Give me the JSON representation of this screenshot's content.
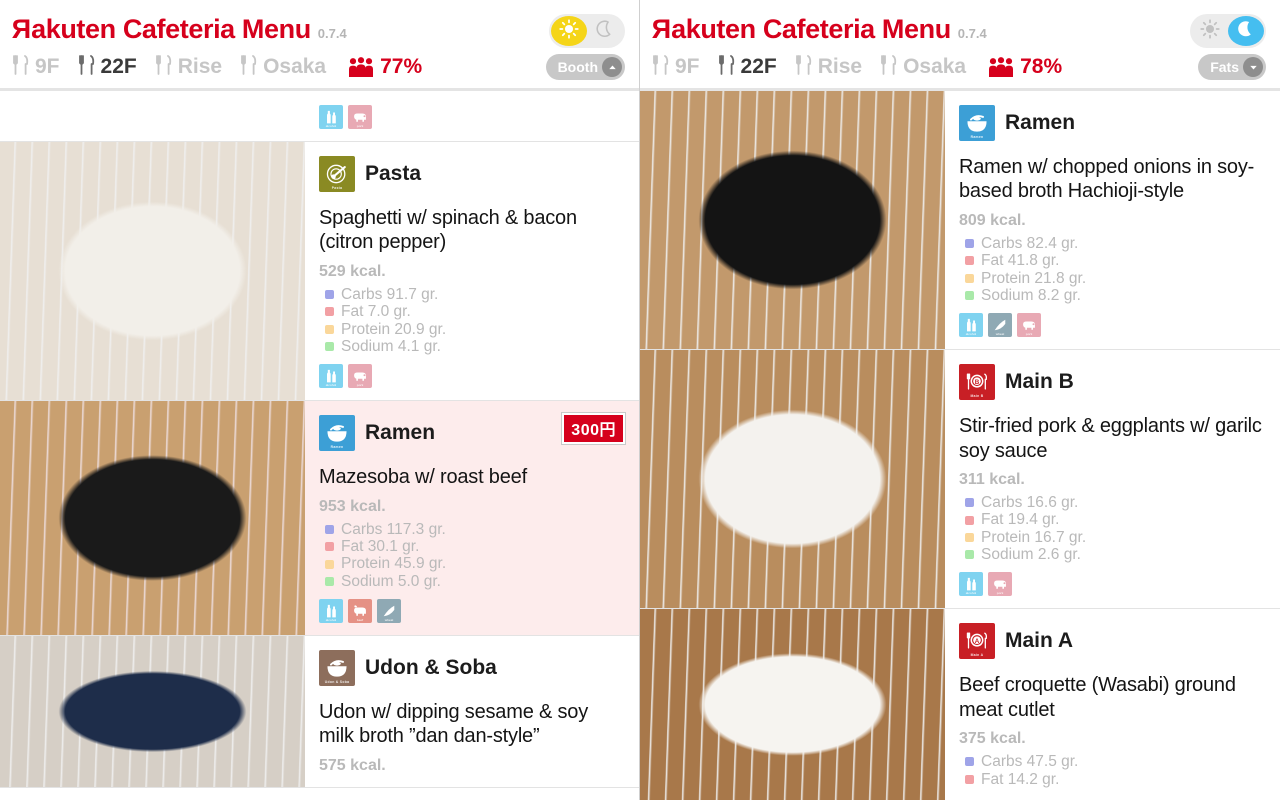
{
  "app": {
    "brand_prefix": "R",
    "brand_rest": "akuten Cafeteria Menu",
    "version": "0.7.4"
  },
  "panels": [
    {
      "id": "left",
      "theme": "day",
      "header": {
        "nav": [
          {
            "label": "9F",
            "active": false
          },
          {
            "label": "22F",
            "active": true
          },
          {
            "label": "Rise",
            "active": false
          },
          {
            "label": "Osaka",
            "active": false
          }
        ],
        "occupancy": "77%",
        "occupancy_icon": "crowd-icon",
        "daynight": {
          "sun_active": true,
          "moon_active": false
        },
        "mode_pill": {
          "label": "Booth",
          "chevron": "chevron-up-icon"
        }
      },
      "cards": [
        {
          "partial": true,
          "position": "top-cropped",
          "allergens": [
            "alcohol",
            "pork"
          ],
          "thumb_colors": [
            "#c8a477",
            "#d8b88c",
            "#2a2a2a"
          ]
        },
        {
          "category": "Pasta",
          "category_color": "#8a8a23",
          "category_icon": "pasta-icon",
          "dish": "Spaghetti w/ spinach & bacon (citron pepper)",
          "kcal": "529 kcal.",
          "nutrients": [
            {
              "label": "Carbs 91.7 gr.",
              "color": "#9fa4e8"
            },
            {
              "label": "Fat 7.0 gr.",
              "color": "#f2a0a4"
            },
            {
              "label": "Protein 20.9 gr.",
              "color": "#fad79a"
            },
            {
              "label": "Sodium 4.1 gr.",
              "color": "#a9e9a9"
            }
          ],
          "allergens": [
            "alcohol",
            "pork"
          ],
          "thumb_colors": [
            "#e7dfd4",
            "#f2efe9",
            "#e8c84a"
          ]
        },
        {
          "category": "Ramen",
          "category_color": "#3c9fd6",
          "category_icon": "ramen-bowl-icon",
          "highlight": true,
          "price": "300円",
          "dish": "Mazesoba w/ roast beef",
          "kcal": "953 kcal.",
          "nutrients": [
            {
              "label": "Carbs 117.3 gr.",
              "color": "#9fa4e8"
            },
            {
              "label": "Fat 30.1 gr.",
              "color": "#f2a0a4"
            },
            {
              "label": "Protein 45.9 gr.",
              "color": "#fad79a"
            },
            {
              "label": "Sodium 5.0 gr.",
              "color": "#a9e9a9"
            }
          ],
          "allergens": [
            "alcohol",
            "beef",
            "wheat"
          ],
          "thumb_colors": [
            "#c9a070",
            "#1a1a1a",
            "#d4616a"
          ]
        },
        {
          "category": "Udon & Soba",
          "category_color": "#8d6e5c",
          "category_icon": "noodle-bowl-icon",
          "dish": "Udon w/ dipping sesame & soy milk broth ”dan dan-style”",
          "kcal": "575 kcal.",
          "nutrients": [],
          "allergens": [],
          "thumb_colors": [
            "#d6cfc6",
            "#1e2d4a",
            "#e8b35a"
          ]
        }
      ]
    },
    {
      "id": "right",
      "theme": "night",
      "header": {
        "nav": [
          {
            "label": "9F",
            "active": false
          },
          {
            "label": "22F",
            "active": true
          },
          {
            "label": "Rise",
            "active": false
          },
          {
            "label": "Osaka",
            "active": false
          }
        ],
        "occupancy": "78%",
        "occupancy_icon": "crowd-icon",
        "daynight": {
          "sun_active": false,
          "moon_active": true
        },
        "mode_pill": {
          "label": "Fats",
          "chevron": "chevron-down-icon"
        }
      },
      "cards": [
        {
          "category": "Ramen",
          "category_color": "#3c9fd6",
          "category_icon": "ramen-bowl-icon",
          "dish": "Ramen w/ chopped onions in soy-based broth Hachioji-style",
          "kcal": "809 kcal.",
          "nutrients": [
            {
              "label": "Carbs 82.4 gr.",
              "color": "#9fa4e8"
            },
            {
              "label": "Fat 41.8 gr.",
              "color": "#f2a0a4"
            },
            {
              "label": "Protein 21.8 gr.",
              "color": "#fad79a"
            },
            {
              "label": "Sodium 8.2 gr.",
              "color": "#a9e9a9"
            }
          ],
          "allergens": [
            "alcohol",
            "wheat",
            "pork"
          ],
          "thumb_colors": [
            "#c2996c",
            "#141414",
            "#e8d8b0"
          ]
        },
        {
          "category": "Main B",
          "category_color": "#c81f25",
          "category_icon": "main-b-icon",
          "dish": "Stir-fried pork & eggplants w/ garilc soy sauce",
          "kcal": "311 kcal.",
          "nutrients": [
            {
              "label": "Carbs 16.6 gr.",
              "color": "#9fa4e8"
            },
            {
              "label": "Fat 19.4 gr.",
              "color": "#f2a0a4"
            },
            {
              "label": "Protein 16.7 gr.",
              "color": "#fad79a"
            },
            {
              "label": "Sodium 2.6 gr.",
              "color": "#a9e9a9"
            }
          ],
          "allergens": [
            "alcohol",
            "pork"
          ],
          "thumb_colors": [
            "#b98d5e",
            "#f4f2ee",
            "#4a3c52"
          ]
        },
        {
          "category": "Main A",
          "category_color": "#c81f25",
          "category_icon": "main-a-icon",
          "dish": "Beef croquette (Wasabi) ground meat cutlet",
          "kcal": "375 kcal.",
          "nutrients": [
            {
              "label": "Carbs 47.5 gr.",
              "color": "#9fa4e8"
            },
            {
              "label": "Fat 14.2 gr.",
              "color": "#f2a0a4"
            }
          ],
          "allergens": [],
          "thumb_colors": [
            "#a8784a",
            "#f6f4f0",
            "#8a4a2a"
          ]
        }
      ]
    }
  ],
  "allergen_labels": {
    "alcohol": "alcohol",
    "pork": "pork",
    "beef": "beef",
    "wheat": "wheat"
  },
  "colors": {
    "brand_red": "#d6001c",
    "sun_yellow": "#f5d518",
    "moon_blue": "#45bef0",
    "highlight_pink": "#fdecec"
  }
}
